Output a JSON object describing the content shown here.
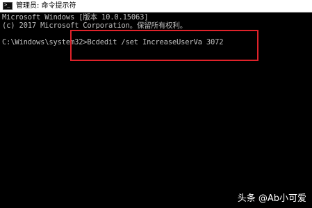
{
  "window": {
    "title": "管理员: 命令提示符",
    "icon": "cmd-icon"
  },
  "console": {
    "lines": [
      "Microsoft Windows [版本 10.0.15063]",
      "(c) 2017 Microsoft Corporation。保留所有权利。",
      "C:\\Windows\\system32>Bcdedit /set IncreaseUserVa 3072"
    ]
  },
  "annotation": {
    "highlight_color": "#e0222a"
  },
  "watermark": {
    "text": "头条 @Ab小可爱"
  }
}
